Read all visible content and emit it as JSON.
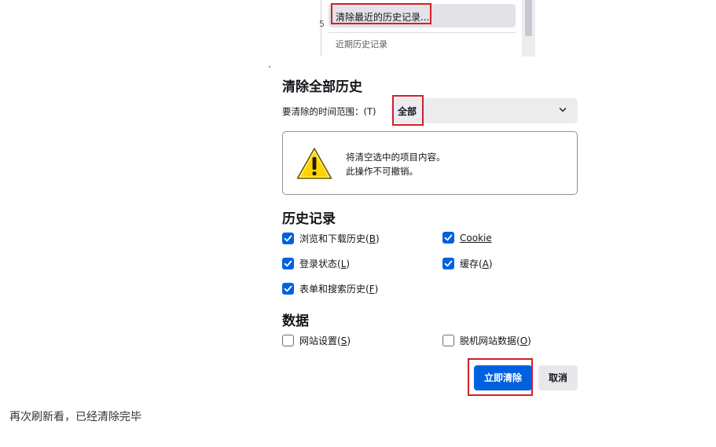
{
  "menu": {
    "clear_recent_label": "清除最近的历史记录...",
    "recent_history_label": "近期历史记录",
    "stray_char": "5"
  },
  "dialog": {
    "title": "清除全部历史",
    "time_range_label": "要清除的时间范围：(T)",
    "time_range_value": "全部",
    "warning_line1": "将清空选中的项目内容。",
    "warning_line2": "此操作不可撤销。",
    "history_section": "历史记录",
    "history_items": [
      {
        "label": "浏览和下载历史",
        "key": "B",
        "checked": true
      },
      {
        "label": "",
        "key": "Cookie",
        "checked": true
      },
      {
        "label": "登录状态",
        "key": "L",
        "checked": true
      },
      {
        "label": "缓存",
        "key": "A",
        "checked": true
      },
      {
        "label": "表单和搜索历史",
        "key": "F",
        "checked": true
      }
    ],
    "data_section": "数据",
    "data_items": [
      {
        "label": "网站设置",
        "key": "S",
        "checked": false
      },
      {
        "label": "脱机网站数据",
        "key": "O",
        "checked": false
      }
    ],
    "clear_now_button": "立即清除",
    "cancel_button": "取消"
  },
  "caption": "再次刷新看，已经清除完毕",
  "colors": {
    "accent": "#0061e0",
    "highlight_border": "#d2202a",
    "warning_yellow": "#ffd400"
  }
}
